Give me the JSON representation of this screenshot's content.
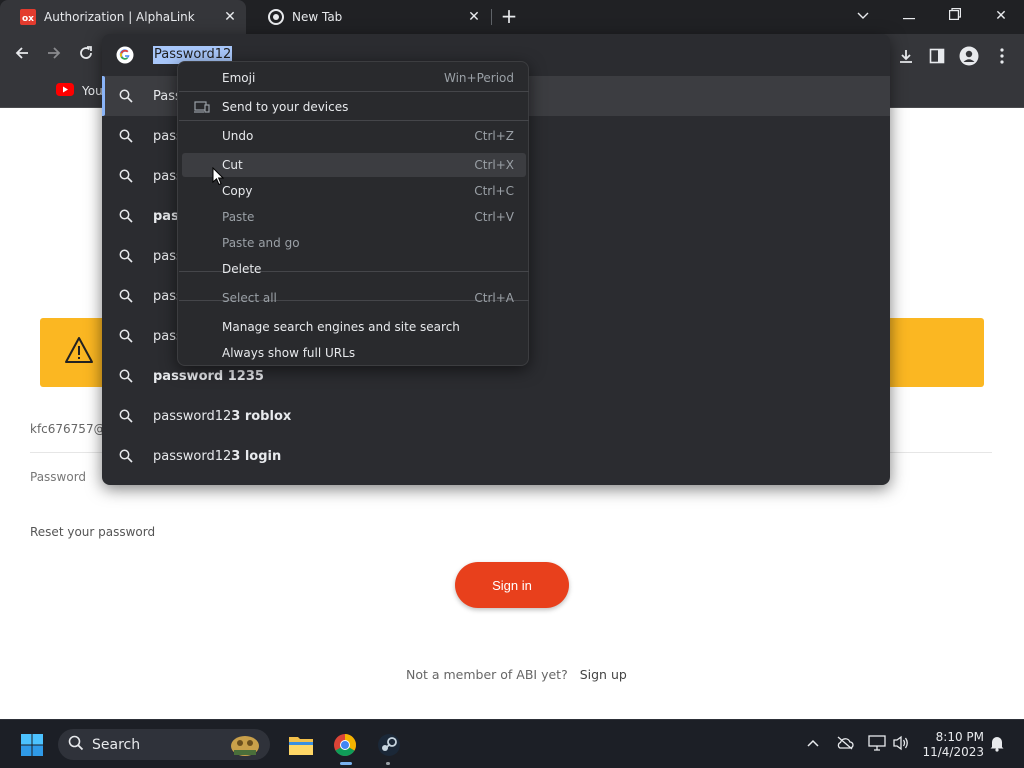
{
  "browser": {
    "tabs": [
      {
        "title": "Authorization | AlphaLink",
        "favicon": "alphalink-icon",
        "active": true
      },
      {
        "title": "New Tab",
        "favicon": "chrome-icon",
        "active": false
      }
    ],
    "new_tab_label": "+",
    "bookmarks": [
      {
        "label": "You",
        "icon": "youtube-icon"
      }
    ]
  },
  "omnibox": {
    "input_value": "Password12",
    "suggestions": [
      {
        "prefix": "Pass",
        "bold": "",
        "selected": true
      },
      {
        "prefix": "pass",
        "bold": ""
      },
      {
        "prefix": "pass",
        "bold": ""
      },
      {
        "prefix": "",
        "bold": "pas"
      },
      {
        "prefix": "pass",
        "bold": ""
      },
      {
        "prefix": "pass",
        "bold": ""
      },
      {
        "prefix": "pass",
        "bold": ""
      },
      {
        "prefix": "",
        "bold": "password 1235"
      },
      {
        "prefix": "password12",
        "bold": "3 roblox"
      },
      {
        "prefix": "password12",
        "bold": "3 login"
      }
    ]
  },
  "context_menu": {
    "items": [
      {
        "label": "Emoji",
        "shortcut": "Win+Period",
        "disabled": false
      },
      {
        "label": "Send to your devices",
        "shortcut": "",
        "disabled": false,
        "icon": "devices-icon"
      },
      {
        "label": "Undo",
        "shortcut": "Ctrl+Z",
        "disabled": false
      },
      {
        "label": "Cut",
        "shortcut": "Ctrl+X",
        "disabled": false,
        "highlighted": true
      },
      {
        "label": "Copy",
        "shortcut": "Ctrl+C",
        "disabled": false
      },
      {
        "label": "Paste",
        "shortcut": "Ctrl+V",
        "disabled": true
      },
      {
        "label": "Paste and go",
        "shortcut": "",
        "disabled": true
      },
      {
        "label": "Delete",
        "shortcut": "",
        "disabled": false
      },
      {
        "label": "Select all",
        "shortcut": "Ctrl+A",
        "disabled": true
      },
      {
        "label": "Manage search engines and site search",
        "shortcut": "",
        "disabled": false
      },
      {
        "label": "Always show full URLs",
        "shortcut": "",
        "disabled": false
      }
    ]
  },
  "page": {
    "email_partial": "kfc676757@",
    "password_label": "Password",
    "reset_link": "Reset your password",
    "signin_button": "Sign in",
    "not_member_text": "Not a member of ABI yet?",
    "signup_link": "Sign up",
    "warning_color": "#fbb722",
    "signin_color": "#e8401c"
  },
  "taskbar": {
    "search_label": "Search",
    "time": "8:10 PM",
    "date": "11/4/2023"
  }
}
